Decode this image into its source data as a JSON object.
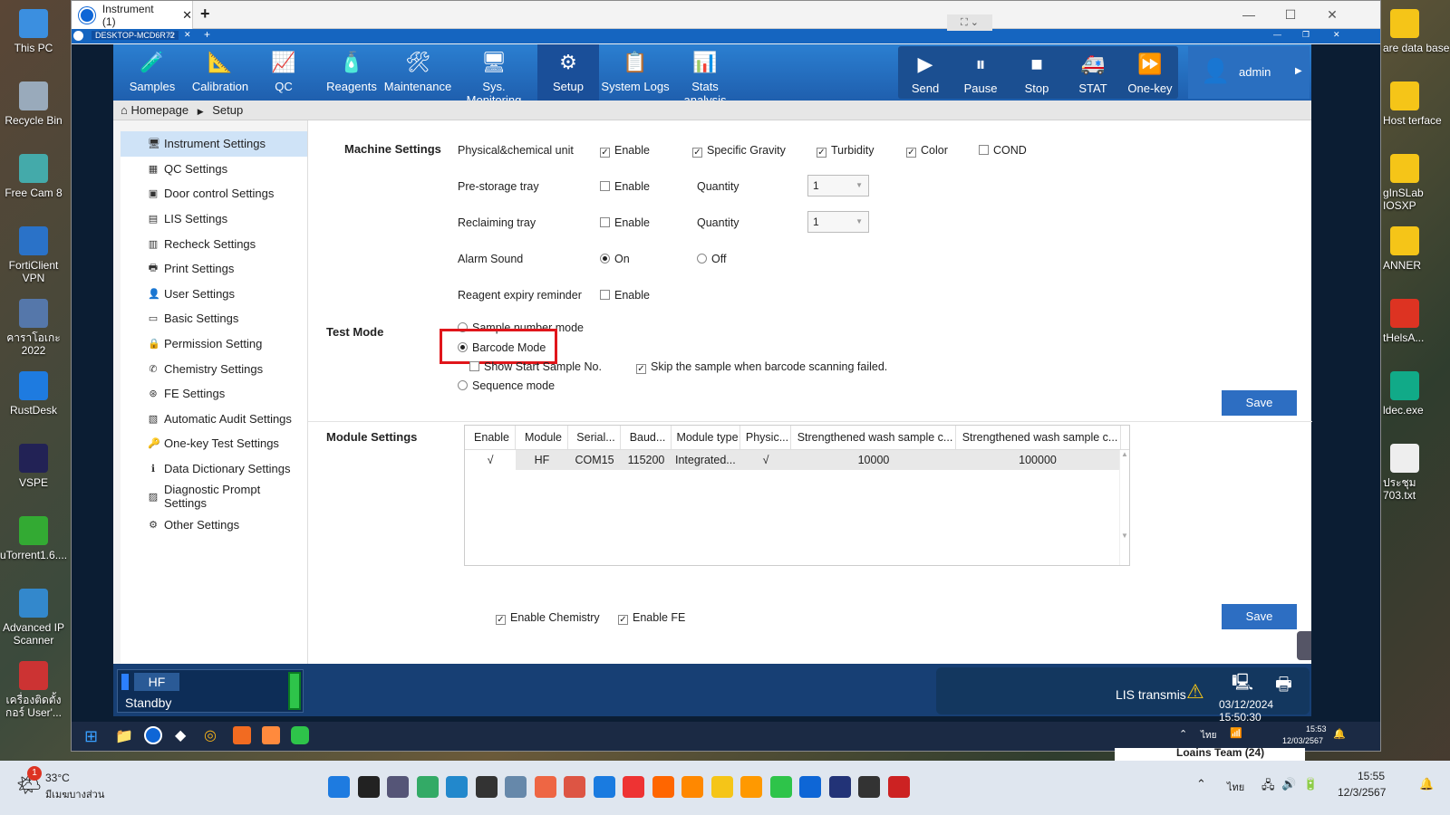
{
  "desktop": {
    "left_icons": [
      "This PC",
      "Recycle Bin",
      "Free Cam 8",
      "FortiClient VPN",
      "คาราโอเกะ 2022",
      "RustDesk",
      "VSPE",
      "uTorrent1.6....",
      "Advanced IP Scanner",
      "เครื่องติดตั้ง กอร์ User'..."
    ],
    "right_icons": [
      "are data base",
      "Host terface",
      "gInSLab IOSXP",
      "ANNER",
      "tHelsA...",
      "ldec.exe",
      "ประชุม 703.txt"
    ]
  },
  "outer_window": {
    "tab_title": "Instrument (1)",
    "inner_tab": "DESKTOP-MCD6R72"
  },
  "toolbar": {
    "left": [
      "Samples",
      "Calibration",
      "QC",
      "Reagents",
      "Maintenance",
      "Sys. Monitoring",
      "Setup",
      "System Logs",
      "Stats analysis"
    ],
    "right": [
      "Send",
      "Pause",
      "Stop",
      "STAT",
      "One-key"
    ],
    "user": "admin"
  },
  "breadcrumb": {
    "home": "Homepage",
    "current": "Setup"
  },
  "sidebar": [
    "Instrument Settings",
    "QC Settings",
    "Door control Settings",
    "LIS Settings",
    "Recheck Settings",
    "Print Settings",
    "User Settings",
    "Basic Settings",
    "Permission Setting",
    "Chemistry Settings",
    "FE Settings",
    "Automatic Audit Settings",
    "One-key Test Settings",
    "Data Dictionary Settings",
    "Diagnostic Prompt Settings",
    "Other Settings"
  ],
  "machine": {
    "title": "Machine Settings",
    "phys_label": "Physical&chemical unit",
    "enable": "Enable",
    "sg": "Specific Gravity",
    "turb": "Turbidity",
    "color": "Color",
    "cond": "COND",
    "prestorage": "Pre-storage tray",
    "reclaiming": "Reclaiming tray",
    "quantity": "Quantity",
    "qty1": "1",
    "qty2": "1",
    "alarm": "Alarm Sound",
    "on": "On",
    "off": "Off",
    "reagent": "Reagent expiry reminder"
  },
  "testmode": {
    "title": "Test Mode",
    "sample_number": "Sample number mode",
    "barcode": "Barcode Mode",
    "show_start": "Show Start Sample No.",
    "skip": "Skip the sample when barcode scanning failed.",
    "sequence": "Sequence mode"
  },
  "save": "Save",
  "module": {
    "title": "Module Settings",
    "headers": [
      "Enable",
      "Module",
      "Serial...",
      "Baud...",
      "Module type",
      "Physic...",
      "Strengthened wash sample c...",
      "Strengthened wash sample c..."
    ],
    "row": [
      "√",
      "HF",
      "COM15",
      "115200",
      "Integrated...",
      "√",
      "10000",
      "100000"
    ]
  },
  "bottom": {
    "chem": "Enable Chemistry",
    "fe": "Enable FE"
  },
  "status": {
    "module": "HF",
    "state": "Standby",
    "lis": "LIS transmis",
    "datetime": "03/12/2024 15:50:30"
  },
  "inner_taskbar": {
    "time": "15:53",
    "date": "12/03/2567",
    "lang": "ไทย"
  },
  "notification_peek": "Loains Team (24)",
  "taskbar": {
    "weather_temp": "33°C",
    "weather_desc": "มีเมฆบางส่วน",
    "badge": "1",
    "lang": "ไทย",
    "time": "15:55",
    "date": "12/3/2567"
  }
}
